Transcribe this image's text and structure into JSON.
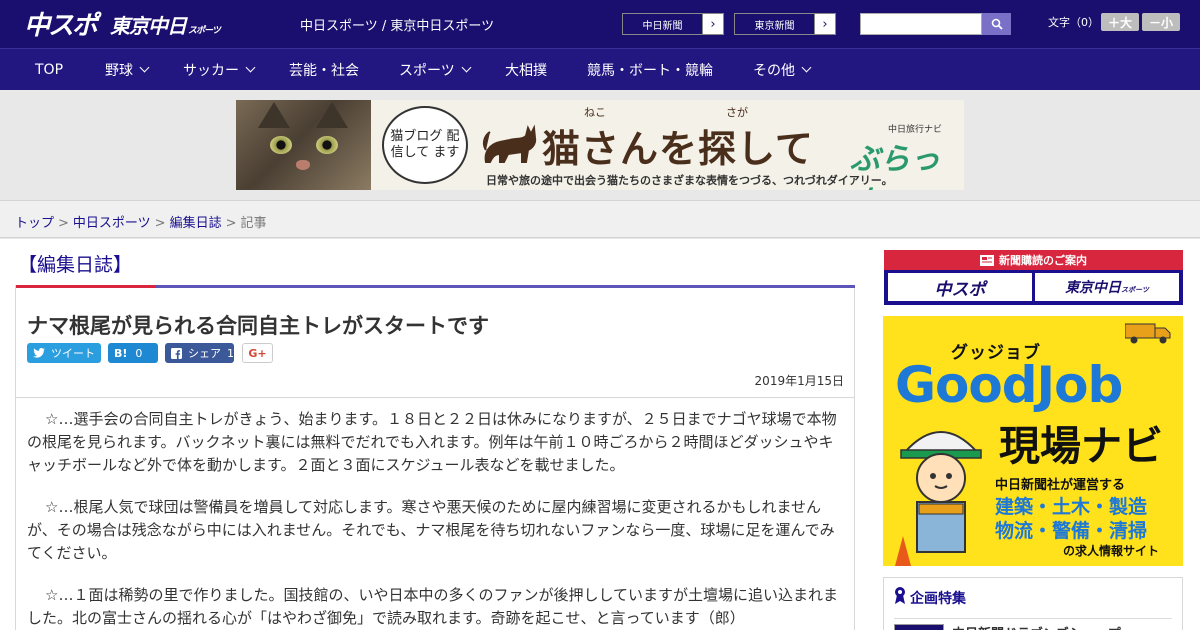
{
  "header": {
    "logo_main": "中スポ",
    "logo_tokyo": "東京中日",
    "logo_tokyo_small": "スポーツ",
    "site_name": "中日スポーツ / 東京中日スポーツ",
    "paper_buttons": [
      "中日新聞",
      "東京新聞"
    ],
    "font_label": "文字（0）",
    "font_plus": "＋大",
    "font_minus": "－小"
  },
  "nav": {
    "items": [
      {
        "label": "TOP",
        "has_menu": false
      },
      {
        "label": "野球",
        "has_menu": true
      },
      {
        "label": "サッカー",
        "has_menu": true
      },
      {
        "label": "芸能・社会",
        "has_menu": false
      },
      {
        "label": "スポーツ",
        "has_menu": true
      },
      {
        "label": "大相撲",
        "has_menu": false
      },
      {
        "label": "競馬・ボート・競輪",
        "has_menu": false
      },
      {
        "label": "その他",
        "has_menu": true
      }
    ]
  },
  "banner": {
    "bubble": "猫ブログ 配信して ます",
    "title": "猫さんを探して",
    "ruby_neko": "ねこ",
    "ruby_saga": "さが",
    "brand_small": "中日旅行ナビ",
    "brand": "ぶらっ人",
    "subtitle": "日常や旅の途中で出会う猫たちのさまざまな表情をつづる、つれづれダイアリー。"
  },
  "breadcrumb": {
    "items": [
      "トップ",
      "中日スポーツ",
      "編集日誌"
    ],
    "current": "記事"
  },
  "article": {
    "section": "【編集日誌】",
    "headline": "ナマ根尾が見られる合同自主トレがスタートです",
    "share": {
      "tweet": "ツイート",
      "hatena": "B!",
      "hatena_count": "0",
      "facebook": "シェア",
      "facebook_count": "1",
      "gplus": "G+"
    },
    "date": "2019年1月15日",
    "paragraphs": [
      "☆…選手会の合同自主トレがきょう、始まります。１８日と２２日は休みになりますが、２５日までナゴヤ球場で本物の根尾を見られます。バックネット裏には無料でだれでも入れます。例年は午前１０時ごろから２時間ほどダッシュやキャッチボールなど外で体を動かします。２面と３面にスケジュール表などを載せました。",
      "☆…根尾人気で球団は警備員を増員して対応します。寒さや悪天候のために屋内練習場に変更されるかもしれませんが、その場合は残念ながら中には入れません。それでも、ナマ根尾を待ち切れないファンなら一度、球場に足を運んでみてください。",
      "☆…１面は稀勢の里で作りました。国技館の、いや日本中の多くのファンが後押ししていますが土壇場に追い込まれました。北の富士さんの揺れる心が「はやわざ御免」で読み取れます。奇跡を起こせ、と言っています（郎）"
    ]
  },
  "sidebar": {
    "subscribe_title": "新聞購読のご案内",
    "subscribe_logos": [
      "中スポ",
      "東京中日"
    ],
    "subscribe_logo_small": "スポーツ",
    "ad": {
      "top": "グッジョブ",
      "title": "GoodJob",
      "navi": "現場ナビ",
      "line1": "中日新聞社が運営する",
      "line2": "建築・土木・製造",
      "line3": "物流・警備・清掃",
      "line4": "の求人情報サイト"
    },
    "feature_title": "企画特集",
    "feature_item": "中日新聞ドラゴンズショップ"
  },
  "colors": {
    "brand_navy": "#1a0f6e",
    "nav_bg": "#221680",
    "accent_red": "#d7263d",
    "accent_blue": "#5d55b8",
    "ad_yellow": "#ffe21c",
    "ad_blue": "#1e78d6"
  }
}
